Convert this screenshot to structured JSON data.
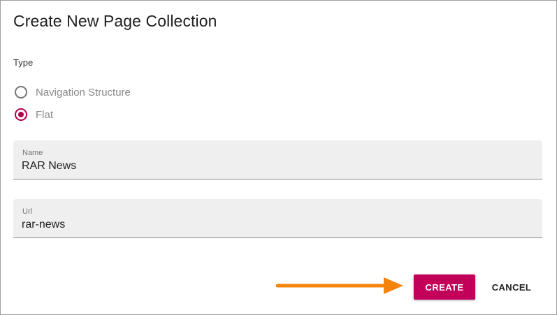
{
  "dialog": {
    "title": "Create New Page Collection",
    "type_label": "Type",
    "type_options": [
      {
        "label": "Navigation Structure",
        "selected": false
      },
      {
        "label": "Flat",
        "selected": true
      }
    ],
    "fields": {
      "name": {
        "label": "Name",
        "value": "RAR News"
      },
      "url": {
        "label": "Url",
        "value": "rar-news"
      }
    },
    "actions": {
      "create_label": "CREATE",
      "cancel_label": "CANCEL"
    }
  },
  "colors": {
    "accent": "#c2005a",
    "annotation_arrow": "#f5840c"
  },
  "icons": {
    "annotation": "arrow-right-icon"
  }
}
